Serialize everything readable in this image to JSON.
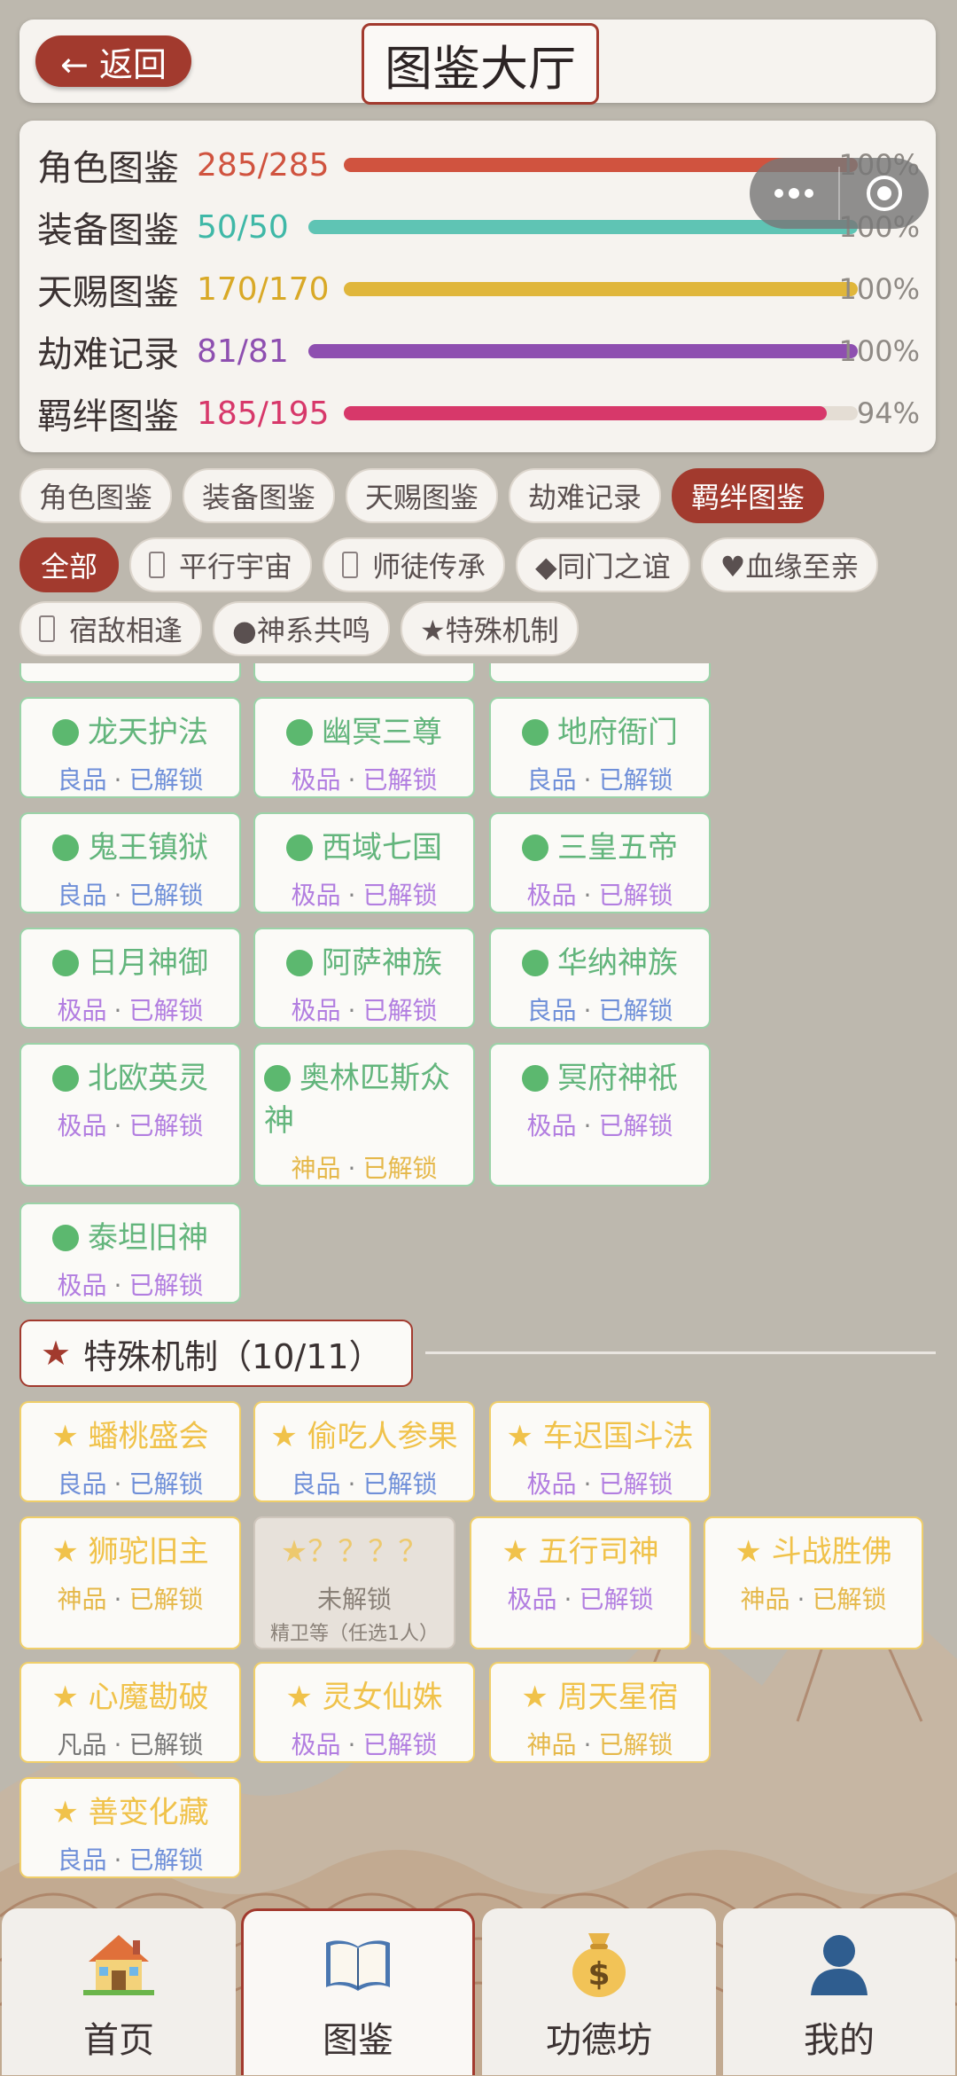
{
  "header": {
    "back_label": "← 返回",
    "title": "图鉴大厅"
  },
  "stats": [
    {
      "label": "角色图鉴",
      "value": "285/285",
      "pct": "100%",
      "fraction": 1.0,
      "color": "#d0533f"
    },
    {
      "label": "装备图鉴",
      "value": "50/50",
      "pct": "100%",
      "fraction": 1.0,
      "color": "#5fc4b4"
    },
    {
      "label": "天赐图鉴",
      "value": "170/170",
      "pct": "100%",
      "fraction": 1.0,
      "color": "#e0b63b"
    },
    {
      "label": "劫难记录",
      "value": "81/81",
      "pct": "100%",
      "fraction": 1.0,
      "color": "#8e4fb0"
    },
    {
      "label": "羁绊图鉴",
      "value": "185/195",
      "pct": "94%",
      "fraction": 0.94,
      "color": "#d7386a"
    }
  ],
  "tabs": [
    "角色图鉴",
    "装备图鉴",
    "天赐图鉴",
    "劫难记录",
    "羁绊图鉴"
  ],
  "active_tab": "羁绊图鉴",
  "filters": {
    "all": "全部",
    "parallel": "平行宇宙",
    "mentor": "师徒传承",
    "sect": "◆同门之谊",
    "blood": "♥血缘至亲",
    "rival": "宿敌相逢",
    "divine": "●神系共鸣",
    "special": "★特殊机制"
  },
  "separator": "·",
  "green_cards": [
    {
      "name": "龙天护法",
      "quality": "良品",
      "status": "已解锁"
    },
    {
      "name": "幽冥三尊",
      "quality": "极品",
      "status": "已解锁"
    },
    {
      "name": "地府衙门",
      "quality": "良品",
      "status": "已解锁"
    },
    {
      "name": "鬼王镇狱",
      "quality": "良品",
      "status": "已解锁"
    },
    {
      "name": "西域七国",
      "quality": "极品",
      "status": "已解锁"
    },
    {
      "name": "三皇五帝",
      "quality": "极品",
      "status": "已解锁"
    },
    {
      "name": "日月神御",
      "quality": "极品",
      "status": "已解锁"
    },
    {
      "name": "阿萨神族",
      "quality": "极品",
      "status": "已解锁"
    },
    {
      "name": "华纳神族",
      "quality": "良品",
      "status": "已解锁"
    },
    {
      "name": "北欧英灵",
      "quality": "极品",
      "status": "已解锁"
    },
    {
      "name": "奥林匹斯众神",
      "quality": "神品",
      "status": "已解锁"
    },
    {
      "name": "冥府神祇",
      "quality": "极品",
      "status": "已解锁"
    },
    {
      "name": "泰坦旧神",
      "quality": "极品",
      "status": "已解锁"
    }
  ],
  "special_section": {
    "title": "特殊机制（10/11）"
  },
  "special_cards": [
    {
      "name": "★ 蟠桃盛会",
      "quality": "良品",
      "status": "已解锁"
    },
    {
      "name": "★ 偷吃人参果",
      "quality": "良品",
      "status": "已解锁"
    },
    {
      "name": "★ 车迟国斗法",
      "quality": "极品",
      "status": "已解锁"
    },
    {
      "name": "★ 狮驼旧主",
      "quality": "神品",
      "status": "已解锁"
    },
    {
      "name": "★？？？？",
      "status": "未解锁",
      "hint": "精卫等（任选1人）"
    },
    {
      "name": "★ 五行司神",
      "quality": "极品",
      "status": "已解锁"
    },
    {
      "name": "★ 斗战胜佛",
      "quality": "神品",
      "status": "已解锁"
    },
    {
      "name": "★ 心魔勘破",
      "quality": "凡品",
      "status": "已解锁"
    },
    {
      "name": "★ 灵女仙姝",
      "quality": "极品",
      "status": "已解锁"
    },
    {
      "name": "★ 周天星宿",
      "quality": "神品",
      "status": "已解锁"
    },
    {
      "name": "★ 善变化藏",
      "quality": "良品",
      "status": "已解锁"
    }
  ],
  "nav": [
    {
      "label": "首页",
      "icon": "house-icon"
    },
    {
      "label": "图鉴",
      "icon": "book-icon"
    },
    {
      "label": "功德坊",
      "icon": "money-bag-icon"
    },
    {
      "label": "我的",
      "icon": "user-icon"
    }
  ],
  "nav_active": "图鉴"
}
